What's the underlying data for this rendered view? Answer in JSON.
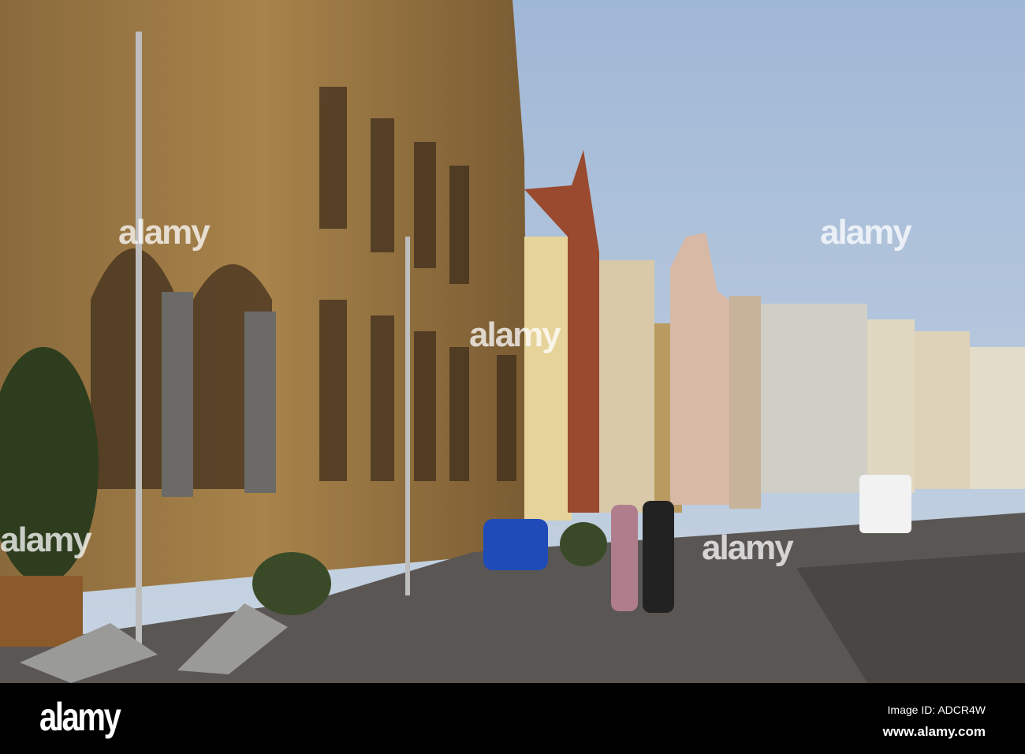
{
  "watermark": {
    "logo": "alamy"
  },
  "footer": {
    "logo": "alamy",
    "image_id": "Image ID: ADCR4W",
    "website": "www.alamy.com"
  }
}
